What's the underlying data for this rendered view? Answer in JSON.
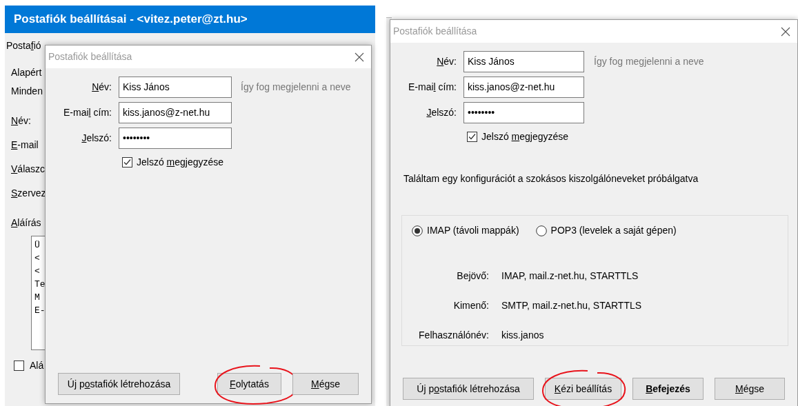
{
  "left_panel": {
    "background_window": {
      "title": "Postafiók beállításai - <vitez.peter@zt.hu>",
      "labels": [
        {
          "pre": "Posta",
          "key": "f",
          "post": "ió"
        },
        {
          "pre": "Alapért"
        },
        {
          "pre": "Minden"
        },
        {
          "key": "N",
          "post": "év:"
        },
        {
          "key": "E",
          "post": "-mail"
        },
        {
          "key": "V",
          "post": "álaszc"
        },
        {
          "key": "S",
          "post": "zervez"
        },
        {
          "key": "A",
          "post": "láírás"
        }
      ],
      "signature_lines": [
        "Ü",
        "<",
        "<",
        "Te",
        "M",
        "E-"
      ],
      "checkbox": {
        "label": "Alá",
        "checked": false
      }
    },
    "dialog": {
      "title": "Postafiók beállítása",
      "fields": [
        {
          "label": {
            "key": "N",
            "post": "év:"
          },
          "value": "Kiss János"
        },
        {
          "label": {
            "pre": "E-mai",
            "key": "l",
            "post": " cím:"
          },
          "value": "kiss.janos@z-net.hu"
        },
        {
          "label": {
            "key": "J",
            "post": "elszó:"
          },
          "value": "••••••••"
        }
      ],
      "hint": "Így fog megjelenni a neve",
      "remember": {
        "label": {
          "pre": "Jelszó ",
          "key": "m",
          "post": "egjegyzése"
        },
        "checked": true
      },
      "buttons": [
        {
          "label": {
            "pre": "Új p",
            "key": "o",
            "post": "stafiók létrehozása"
          },
          "default": false,
          "circled": false,
          "kind": "left"
        },
        {
          "label": {
            "key": "F",
            "post": "olytatás"
          },
          "default": false,
          "circled": true,
          "kind": "right"
        },
        {
          "label": {
            "key": "M",
            "post": "égse"
          },
          "default": false,
          "circled": false,
          "kind": "right"
        }
      ]
    }
  },
  "right_panel": {
    "dialog": {
      "title": "Postafiók beállítása",
      "fields": [
        {
          "label": {
            "key": "N",
            "post": "év:"
          },
          "value": "Kiss János"
        },
        {
          "label": {
            "pre": "E-mai",
            "key": "l",
            "post": " cím:"
          },
          "value": "kiss.janos@z-net.hu"
        },
        {
          "label": {
            "key": "J",
            "post": "elszó:"
          },
          "value": "••••••••"
        }
      ],
      "hint": "Így fog megjelenni a neve",
      "remember": {
        "label": {
          "pre": "Jelszó ",
          "key": "m",
          "post": "egjegyzése"
        },
        "checked": true
      },
      "message": "Találtam egy konfigurációt a szokásos kiszolgálóneveket próbálgatva",
      "protocols": [
        {
          "label": "IMAP (távoli mappák)",
          "selected": true
        },
        {
          "label": "POP3 (levelek a saját gépen)",
          "selected": false
        }
      ],
      "details": [
        {
          "label": "Bejövő:",
          "value": "IMAP, mail.z-net.hu, STARTTLS"
        },
        {
          "label": "Kimenő:",
          "value": "SMTP, mail.z-net.hu, STARTTLS"
        },
        {
          "label": "Felhasználónév:",
          "value": "kiss.janos"
        }
      ],
      "buttons": [
        {
          "label": {
            "pre": "Új p",
            "key": "o",
            "post": "stafiók létrehozása"
          },
          "default": false,
          "circled": false
        },
        {
          "label": {
            "key": "K",
            "post": "ézi beállítás"
          },
          "default": false,
          "circled": true
        },
        {
          "label": {
            "key": "B",
            "post": "efejezés"
          },
          "default": true,
          "circled": false
        },
        {
          "label": {
            "key": "M",
            "post": "égse"
          },
          "default": false,
          "circled": false
        }
      ]
    }
  }
}
